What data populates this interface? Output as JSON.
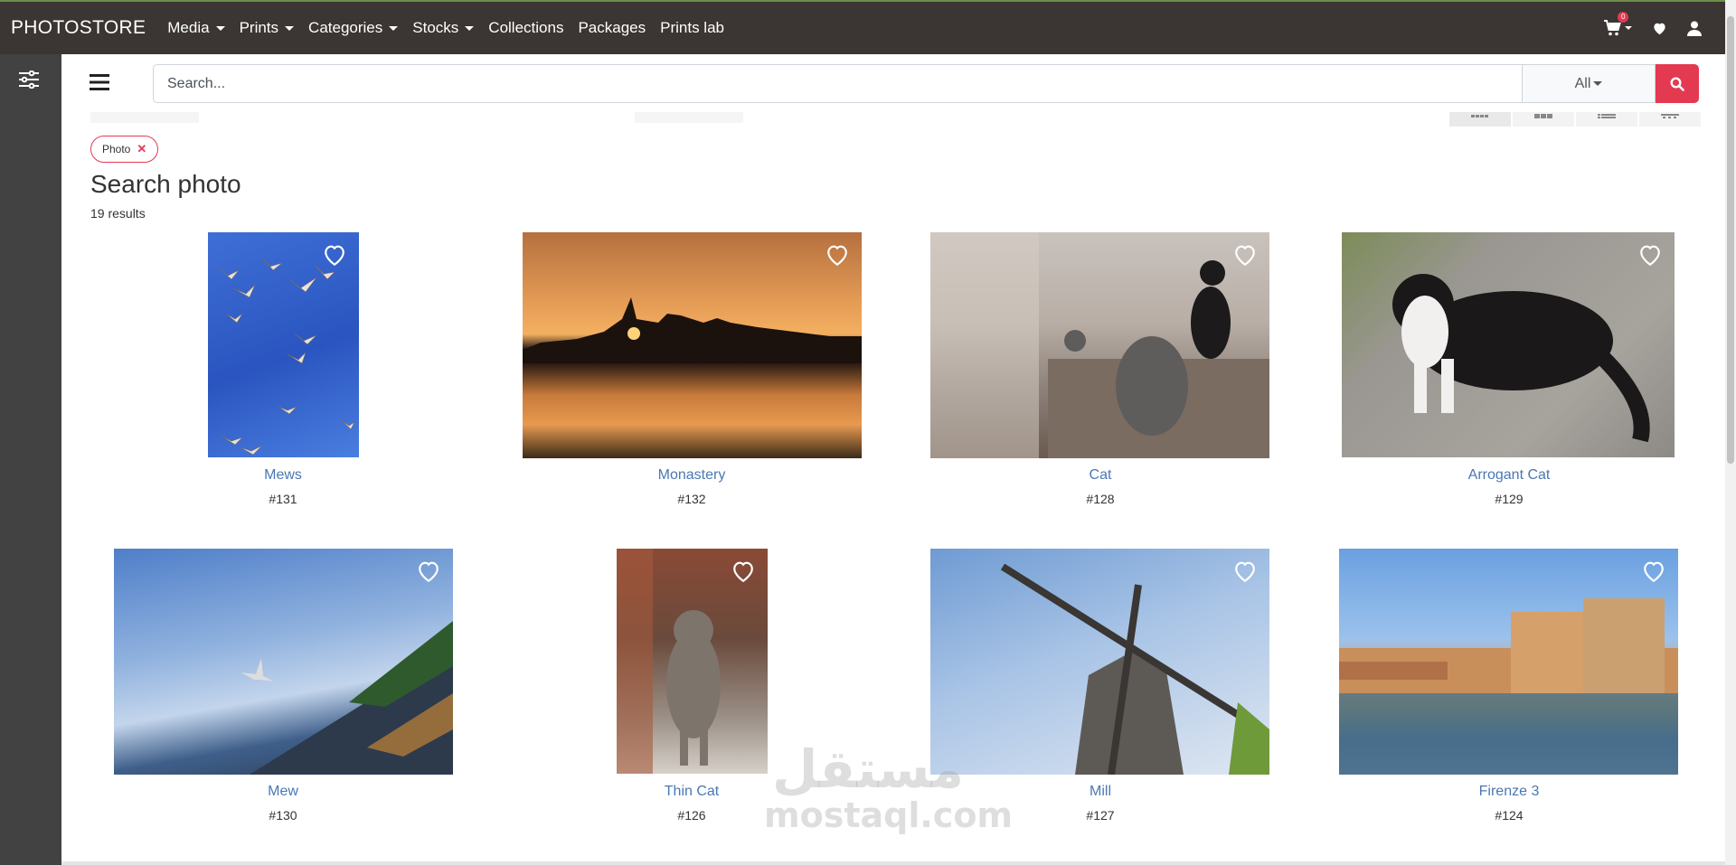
{
  "nav": {
    "brand": "PHOTOSTORE",
    "items": [
      {
        "label": "Media",
        "dropdown": true
      },
      {
        "label": "Prints",
        "dropdown": true
      },
      {
        "label": "Categories",
        "dropdown": true
      },
      {
        "label": "Stocks",
        "dropdown": true
      },
      {
        "label": "Collections",
        "dropdown": false
      },
      {
        "label": "Packages",
        "dropdown": false
      },
      {
        "label": "Prints lab",
        "dropdown": false
      }
    ],
    "cart_count": "0",
    "icons": [
      "cart-icon",
      "heart-icon",
      "user-icon"
    ]
  },
  "search": {
    "placeholder": "Search...",
    "scope": "All"
  },
  "filters": {
    "active_chip": "Photo"
  },
  "results": {
    "title": "Search photo",
    "count_text": "19 results"
  },
  "photos": [
    {
      "title": "Mews",
      "id": "#131"
    },
    {
      "title": "Monastery",
      "id": "#132"
    },
    {
      "title": "Cat",
      "id": "#128"
    },
    {
      "title": "Arrogant Cat",
      "id": "#129"
    },
    {
      "title": "Mew",
      "id": "#130"
    },
    {
      "title": "Thin Cat",
      "id": "#126"
    },
    {
      "title": "Mill",
      "id": "#127"
    },
    {
      "title": "Firenze 3",
      "id": "#124"
    }
  ],
  "watermark": {
    "arabic": "مستقل",
    "latin": "mostaql.com"
  },
  "colors": {
    "topbar": "#3b3533",
    "sidebar": "#424242",
    "accent": "#e33a52",
    "link": "#4a77b4"
  }
}
